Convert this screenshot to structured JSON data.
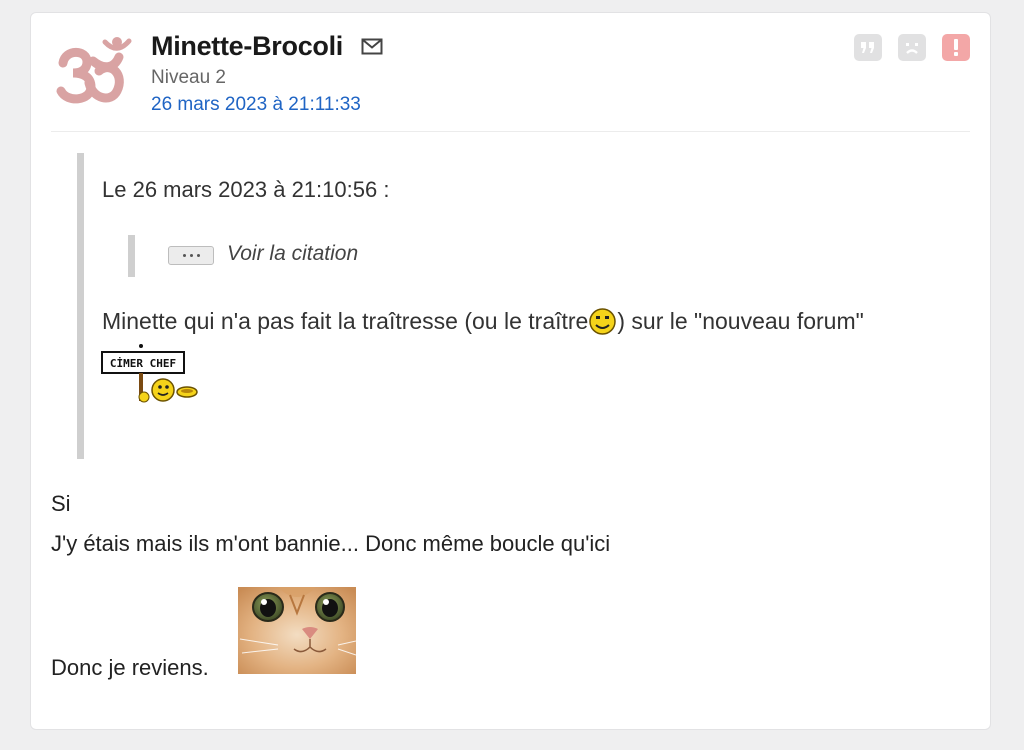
{
  "post": {
    "author": "Minette-Brocoli",
    "level": "Niveau 2",
    "date": "26 mars 2023 à 21:11:33",
    "icons": {
      "avatar": "om-symbol-avatar",
      "mail": "mail-icon",
      "quote": "quote-icon",
      "sad": "sad-face-icon",
      "report": "alert-icon"
    },
    "colors": {
      "link": "#1f64c4",
      "avatar": "#d9a3a3",
      "report": "#f3a7a7"
    }
  },
  "quote": {
    "header": "Le 26 mars 2023 à 21:10:56 :",
    "nested_label": "Voir la citation",
    "text_part1": "Minette qui n'a pas fait la traîtresse (ou le traître ",
    "text_part2": ") sur le \"nouveau forum\"",
    "sticker_text": "CİMER CHEF"
  },
  "body": {
    "line1": "Si",
    "line2": "J'y étais mais ils m'ont bannie... Donc même boucle qu'ici",
    "line3": "Donc je reviens."
  }
}
